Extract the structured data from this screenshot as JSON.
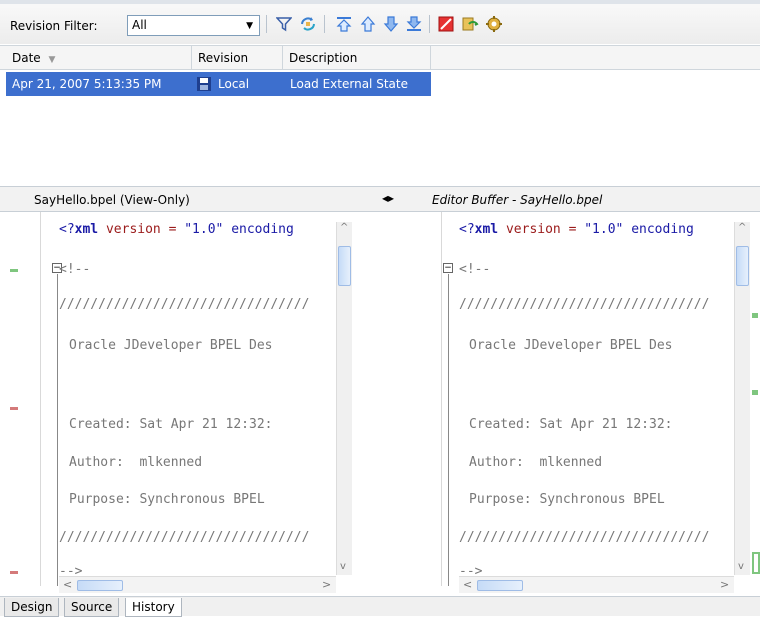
{
  "toolbar": {
    "filter_label": "Revision Filter:",
    "filter_value": "All",
    "icons": [
      "filter-icon",
      "refresh-icon",
      "first-diff-icon",
      "prev-diff-icon",
      "next-diff-icon",
      "last-diff-icon",
      "clear-icon",
      "restore-icon",
      "settings-icon"
    ]
  },
  "table": {
    "columns": [
      "Date",
      "Revision",
      "Description"
    ],
    "rows": [
      {
        "date": "Apr 21, 2007 5:13:35 PM",
        "revision": "Local",
        "description": "Load External State"
      }
    ]
  },
  "compare": {
    "left_title": "SayHello.bpel (View-Only)",
    "right_title": "Editor Buffer - SayHello.bpel",
    "lines": [
      {
        "text": "<?xml version = \"1.0\" encoding"
      },
      {
        "text": "<!--"
      },
      {
        "text": "////////////////////////////////"
      },
      {
        "text": "Oracle JDeveloper BPEL Des"
      },
      {
        "text": ""
      },
      {
        "text": "Created: Sat Apr 21 12:32:"
      },
      {
        "text": "Author:  mlkenned"
      },
      {
        "text": "Purpose: Synchronous BPEL"
      },
      {
        "text": "////////////////////////////////"
      },
      {
        "text": "-->"
      }
    ]
  },
  "tabs": [
    "Design",
    "Source",
    "History"
  ],
  "active_tab": "History",
  "colors": {
    "selection": "#3d6fce",
    "xml_keyword": "#1a1aa6",
    "xml_string": "#9b1b1b"
  }
}
